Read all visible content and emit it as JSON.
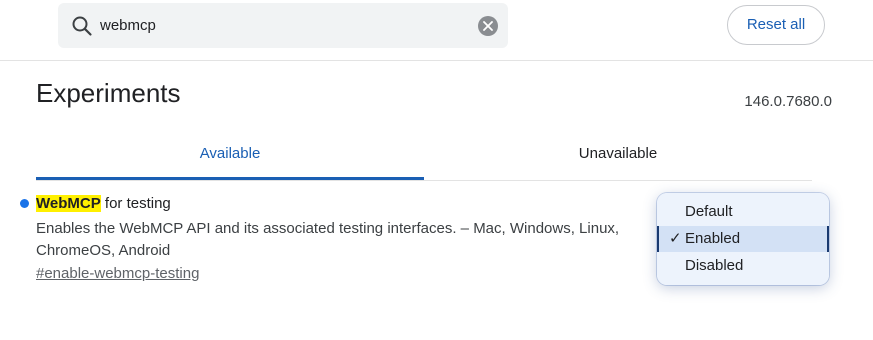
{
  "search": {
    "value": "webmcp",
    "icon": "search-icon",
    "clear_icon": "clear-icon"
  },
  "toolbar": {
    "reset_label": "Reset all"
  },
  "page": {
    "title": "Experiments",
    "version": "146.0.7680.0"
  },
  "tabs": [
    {
      "label": "Available",
      "selected": true
    },
    {
      "label": "Unavailable",
      "selected": false
    }
  ],
  "experiment": {
    "title_highlight": "WebMCP",
    "title_rest": " for testing",
    "description": "Enables the WebMCP API and its associated testing interfaces. – Mac, Windows, Linux, ChromeOS, Android",
    "link": "#enable-webmcp-testing",
    "dropdown": {
      "options": [
        "Default",
        "Enabled",
        "Disabled"
      ],
      "selected": "Enabled",
      "check_mark": "✓"
    }
  },
  "colors": {
    "accent": "#1a5fb4",
    "highlight": "#fff000",
    "dot": "#1a73e8"
  }
}
